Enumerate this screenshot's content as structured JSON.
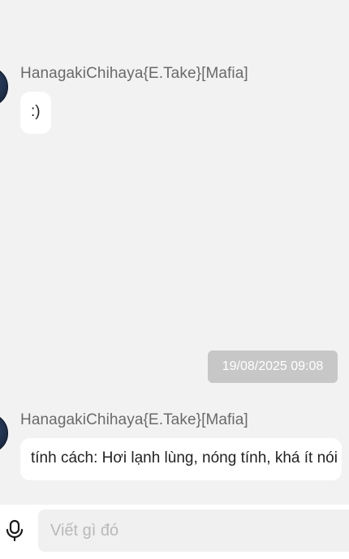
{
  "messages": [
    {
      "sender": "HanagakiChihaya{E.Take}[Mafia]",
      "text": ":)"
    },
    {
      "sender": "HanagakiChihaya{E.Take}[Mafia]",
      "text": "tính cách: Hơi lạnh lùng, nóng tính, khá ít nói"
    }
  ],
  "timestamp": "19/08/2025 09:08",
  "composer": {
    "placeholder": "Viết gì đó",
    "value": "",
    "mic_icon": "microphone-icon"
  },
  "colors": {
    "background": "#f2f2f2",
    "bubble": "#ffffff",
    "sender_text": "#6a6a6a",
    "timestamp_badge": "#c7c7c7",
    "input_background": "#f0f0f0"
  }
}
